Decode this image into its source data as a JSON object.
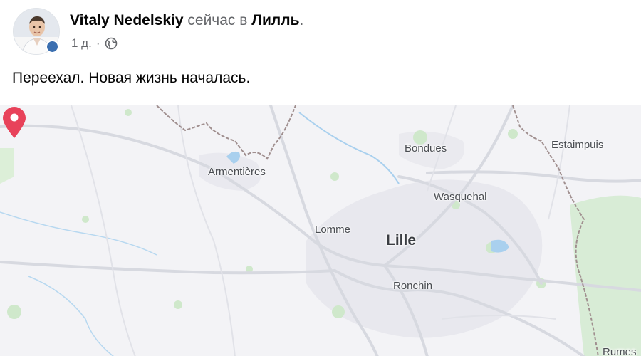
{
  "post": {
    "author": "Vitaly Nedelskiy",
    "status_text": "сейчас в",
    "place": "Лилль",
    "place_suffix": ".",
    "time": "1 д.",
    "separator": "·",
    "text": "Переехал. Новая жизнь началась."
  },
  "icons": {
    "avatar": "profile-photo",
    "badge": "avatar-badge",
    "audience": "globe-icon",
    "pin": "map-pin-icon"
  },
  "map": {
    "labels": {
      "armentieres": "Armentières",
      "bondues": "Bondues",
      "estaimpuis": "Estaimpuis",
      "wasquehal": "Wasquehal",
      "lomme": "Lomme",
      "lille": "Lille",
      "ronchin": "Ronchin",
      "rumes": "Rumes"
    },
    "colors": {
      "background": "#f3f3f6",
      "roads": "#d9dbe2",
      "urban": "#e6e6ec",
      "green": "#c8e6c8",
      "water": "#9cc8e8",
      "border": "#9c8a8a",
      "pin": "#e8425a"
    }
  }
}
